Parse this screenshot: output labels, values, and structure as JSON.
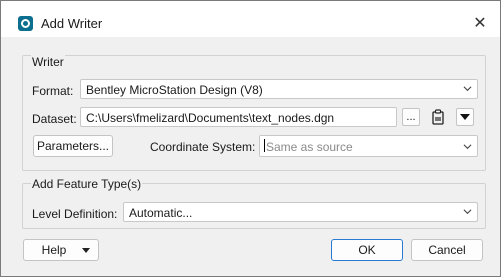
{
  "window": {
    "title": "Add Writer"
  },
  "writer_group": {
    "title": "Writer",
    "format_label": "Format:",
    "format_value": "Bentley MicroStation Design (V8)",
    "dataset_label": "Dataset:",
    "dataset_value": "C:\\Users\\fmelizard\\Documents\\text_nodes.dgn",
    "browse_label": "...",
    "parameters_label": "Parameters...",
    "coord_label": "Coordinate System:",
    "coord_placeholder": "Same as source"
  },
  "feature_group": {
    "title": "Add Feature Type(s)",
    "level_label": "Level Definition:",
    "level_value": "Automatic..."
  },
  "footer": {
    "help_label": "Help",
    "ok_label": "OK",
    "cancel_label": "Cancel"
  },
  "icons": {
    "app": "fme-app-icon",
    "close": "close-icon",
    "chevron": "chevron-down-icon",
    "clipboard": "clipboard-icon",
    "dropdown": "triangle-down-icon"
  },
  "colors": {
    "accent": "#2a7ad1",
    "app_icon": "#0d6f8f"
  }
}
